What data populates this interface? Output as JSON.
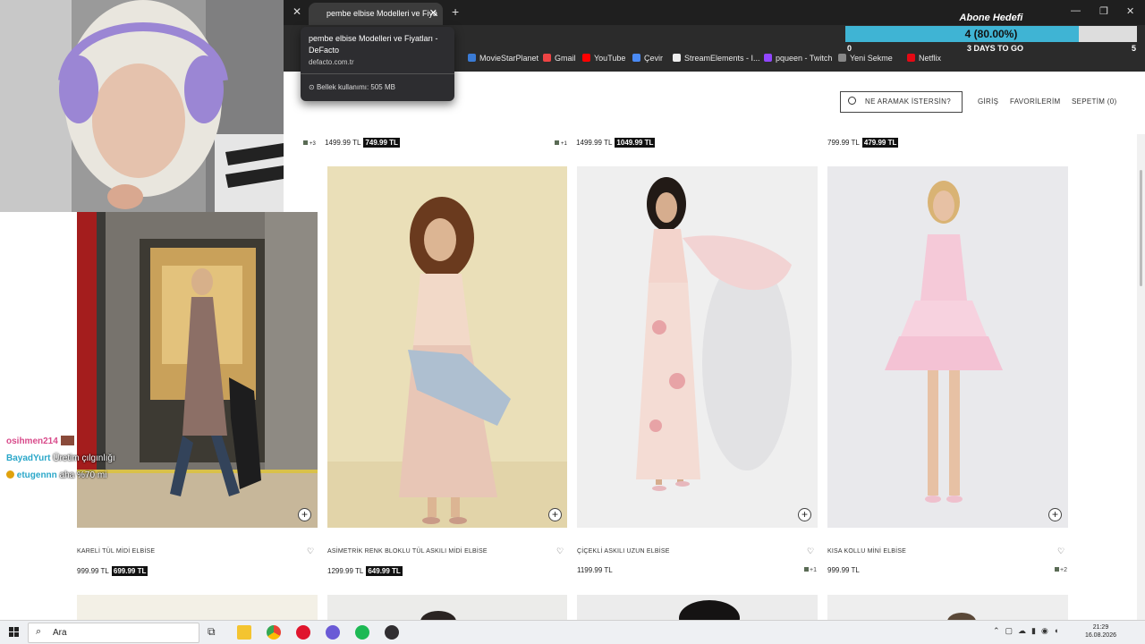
{
  "browser": {
    "tab_title": "pembe elbise Modelleri ve Fiya",
    "hovercard_title": "pembe elbise Modelleri ve Fiyatları - DeFacto",
    "hovercard_url": "defacto.com.tr",
    "memory_label": "Bellek kullanımı: 505 MB",
    "bookmarks": [
      "MovieStarPlanet",
      "Gmail",
      "YouTube",
      "Çevir",
      "StreamElements - I...",
      "pqueen - Twitch",
      "Yeni Sekme",
      "Netflix"
    ]
  },
  "goal": {
    "title": "Abone Hedefi",
    "value_text": "4 (80.00%)",
    "progress": 0.8,
    "start": "0",
    "end": "5",
    "remaining": "3 DAYS TO GO"
  },
  "header": {
    "search_placeholder": "NE ARAMAK İSTERSİN?",
    "login": "GİRİŞ",
    "favorites": "FAVORİLERİM",
    "cart": "SEPETİM (0)"
  },
  "top_prices": [
    {
      "swatch": "+3",
      "old": "1499.99 TL",
      "sale": "749.99 TL"
    },
    {
      "swatch": "+1",
      "old": "1499.99 TL",
      "sale": "1049.99 TL"
    },
    {
      "swatch": "",
      "old": "799.99 TL",
      "sale": "479.99 TL"
    }
  ],
  "products": [
    {
      "name": "KARELİ TÜL MİDİ ELBİSE",
      "old": "999.99 TL",
      "sale": "699.99 TL",
      "swatch": ""
    },
    {
      "name": "ASİMETRİK RENK BLOKLU TÜL ASKILI MİDİ ELBİSE",
      "old": "1299.99 TL",
      "sale": "649.99 TL",
      "swatch": ""
    },
    {
      "name": "ÇİÇEKLİ ASKILI UZUN ELBİSE",
      "old": "1199.99 TL",
      "sale": "",
      "swatch": "+1"
    },
    {
      "name": "KISA KOLLU MİNİ ELBİSE",
      "old": "999.99 TL",
      "sale": "",
      "swatch": "+2"
    }
  ],
  "chat": [
    {
      "user": "osihmen214",
      "message": "",
      "color": "#d84a8a"
    },
    {
      "user": "BayadYurt",
      "message": "Üretim çılgınlığı",
      "color": "#2aa7c9"
    },
    {
      "user": "etugennn",
      "message": "aha %70 mi",
      "color": "#2aa7c9"
    }
  ],
  "taskbar": {
    "search_label": "Ara",
    "time": "21:29",
    "date": "16.08.2026"
  }
}
